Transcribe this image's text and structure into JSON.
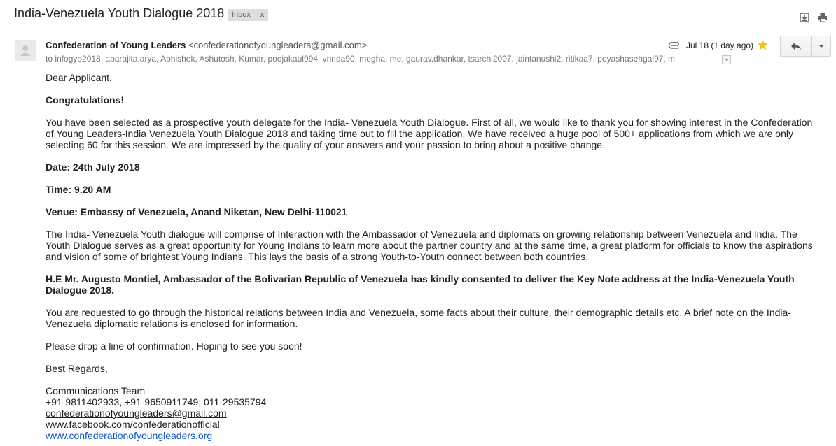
{
  "header": {
    "subject": "India-Venezuela Youth Dialogue 2018",
    "label": "Inbox",
    "label_remove": "x",
    "icons": [
      "download-icon",
      "print-icon"
    ]
  },
  "message": {
    "sender_name": "Confederation of Young Leaders",
    "sender_email": "<confederationofyoungleaders@gmail.com>",
    "recipients": "to infogyo2018, aparajita.arya, Abhishek, Ashutosh, Kumar, poojakaul994, vrinda90, megha, me, gaurav.dhankar, tsarchi2007, jaintanushi2, ritikaa7, peyashasehgal97, m",
    "date": "Jul 18 (1 day ago)",
    "icons": [
      "attachment-icon",
      "star-icon",
      "reply-icon",
      "more-caret-icon",
      "avatar"
    ],
    "colors": {
      "star": "#f5c518",
      "link": "#1155cc"
    }
  },
  "body": {
    "greeting": "Dear Applicant,",
    "congrats": "Congratulations!",
    "para1": "You have been selected as a prospective youth delegate for the India- Venezuela Youth Dialogue. First of all, we would like to thank you for showing interest in the Confederation of Young Leaders-India Venezuela Youth Dialogue 2018 and taking time out to fill the application. We have received a huge pool of 500+ applications from which we are only selecting 60 for this session. We are impressed by the quality of your answers and your passion to bring about a positive change.",
    "date_line": "Date:  24th July 2018",
    "time_line": "Time:  9.20 AM",
    "venue_line": "Venue: Embassy of Venezuela, Anand Niketan, New Delhi-110021",
    "para2": "The India- Venezuela Youth dialogue will comprise of Interaction with the Ambassador of  Venezuela and diplomats on growing relationship between Venezuela and India. The Youth Dialogue serves as a great opportunity for Young Indians to learn more about the partner country and at the same time, a great platform for officials to know the aspirations and vision of some of brightest Young Indians. This lays the basis of a strong Youth-to-Youth connect between both countries.",
    "ambassador_line": "H.E Mr. Augusto Montiel, Ambassador of the Bolivarian Republic of Venezuela has kindly consented to deliver the Key Note address at the India-Venezuela Youth Dialogue 2018.",
    "para3": "You are requested to go through the historical relations between India and Venezuela, some facts about their culture, their demographic details etc. A brief note on the India-Venezuela diplomatic relations is enclosed for information.",
    "para4": "Please drop a line of confirmation. Hoping to see you soon!",
    "regards": "Best Regards,",
    "signature": {
      "team": "Communications Team",
      "phones": "+91-9811402933, +91-9650911749; 011-29535794",
      "email": "confederationofyoungleaders@gmail.com",
      "facebook": "www.facebook.com/confederationofficial",
      "website": "www.confederationofyoungleaders.org"
    }
  }
}
